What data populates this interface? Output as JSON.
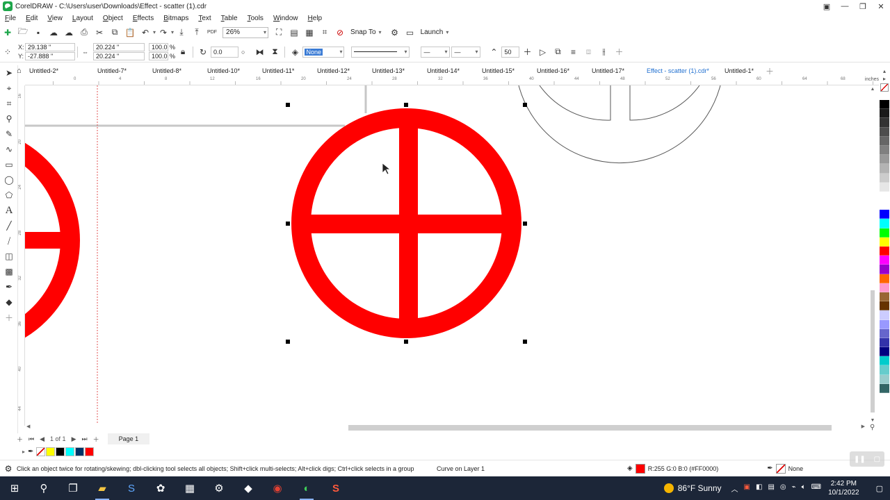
{
  "window": {
    "title": "CorelDRAW - C:\\Users\\user\\Downloads\\Effect - scatter (1).cdr",
    "minimize": "—",
    "maximize": "❐",
    "close": "✕"
  },
  "menu": [
    "File",
    "Edit",
    "View",
    "Layout",
    "Object",
    "Effects",
    "Bitmaps",
    "Text",
    "Table",
    "Tools",
    "Window",
    "Help"
  ],
  "toolbar": {
    "zoom": "26%",
    "snap_to": "Snap To",
    "launch": "Launch",
    "pdf_label": "PDF"
  },
  "property_bar": {
    "x": "29.138 \"",
    "y": "-27.888 \"",
    "x_label": "X:",
    "y_label": "Y:",
    "width": "20.224 \"",
    "height": "20.224 \"",
    "scale_w": "100.0",
    "scale_h": "100.0",
    "percent": "%",
    "angle": "0.0",
    "fill": "None",
    "smoothing": "50"
  },
  "tabs": [
    {
      "label": "Untitled-2*"
    },
    {
      "label": "Untitled-7*"
    },
    {
      "label": "Untitled-8*"
    },
    {
      "label": "Untitled-10*"
    },
    {
      "label": "Untitled-11*"
    },
    {
      "label": "Untitled-12*"
    },
    {
      "label": "Untitled-13*"
    },
    {
      "label": "Untitled-14*"
    },
    {
      "label": "Untitled-15*"
    },
    {
      "label": "Untitled-16*"
    },
    {
      "label": "Untitled-17*"
    },
    {
      "label": "Effect - scatter (1).cdr*",
      "active": true
    },
    {
      "label": "Untitled-1*"
    }
  ],
  "ruler": {
    "units": "inches",
    "h_ticks": [
      "0",
      "4",
      "8",
      "12",
      "16",
      "20",
      "24",
      "28",
      "32",
      "36",
      "40",
      "44",
      "48",
      "52",
      "56",
      "60",
      "64",
      "68"
    ],
    "v_ticks": [
      "16",
      "20",
      "24",
      "28",
      "32",
      "36",
      "40",
      "44"
    ]
  },
  "page_nav": {
    "count": "1 of 1",
    "page_label": "Page 1"
  },
  "status": {
    "hint": "Click an object twice for rotating/skewing; dbl-clicking tool selects all objects; Shift+click multi-selects; Alt+click digs; Ctrl+click selects in a group",
    "object": "Curve on Layer 1",
    "fill_info": "R:255 G:0 B:0 (#FF0000)",
    "outline": "None"
  },
  "colors": {
    "shape_fill": "#ff0000",
    "accent": "#1f6fd0"
  },
  "palette": [
    "#000000",
    "#1a1a1a",
    "#333333",
    "#4d4d4d",
    "#666666",
    "#808080",
    "#999999",
    "#b3b3b3",
    "#cccccc",
    "#e6e6e6",
    "#ffffff",
    "#ffffff",
    "#0000ff",
    "#00ffff",
    "#00ff00",
    "#ffff00",
    "#ff0000",
    "#ff00ff",
    "#9900cc",
    "#ff6600",
    "#ff99cc",
    "#996633",
    "#663300",
    "#ccccff",
    "#9999ff",
    "#6666cc",
    "#3333aa",
    "#000080",
    "#00cccc",
    "#66cccc",
    "#99cccc",
    "#336666"
  ],
  "doc_palette": [
    "none",
    "#ffff00",
    "#000000",
    "#00ffff",
    "#003366",
    "#ff0000"
  ],
  "taskbar": {
    "weather": "86°F  Sunny",
    "time": "2:42 PM",
    "date": "10/1/2022"
  }
}
